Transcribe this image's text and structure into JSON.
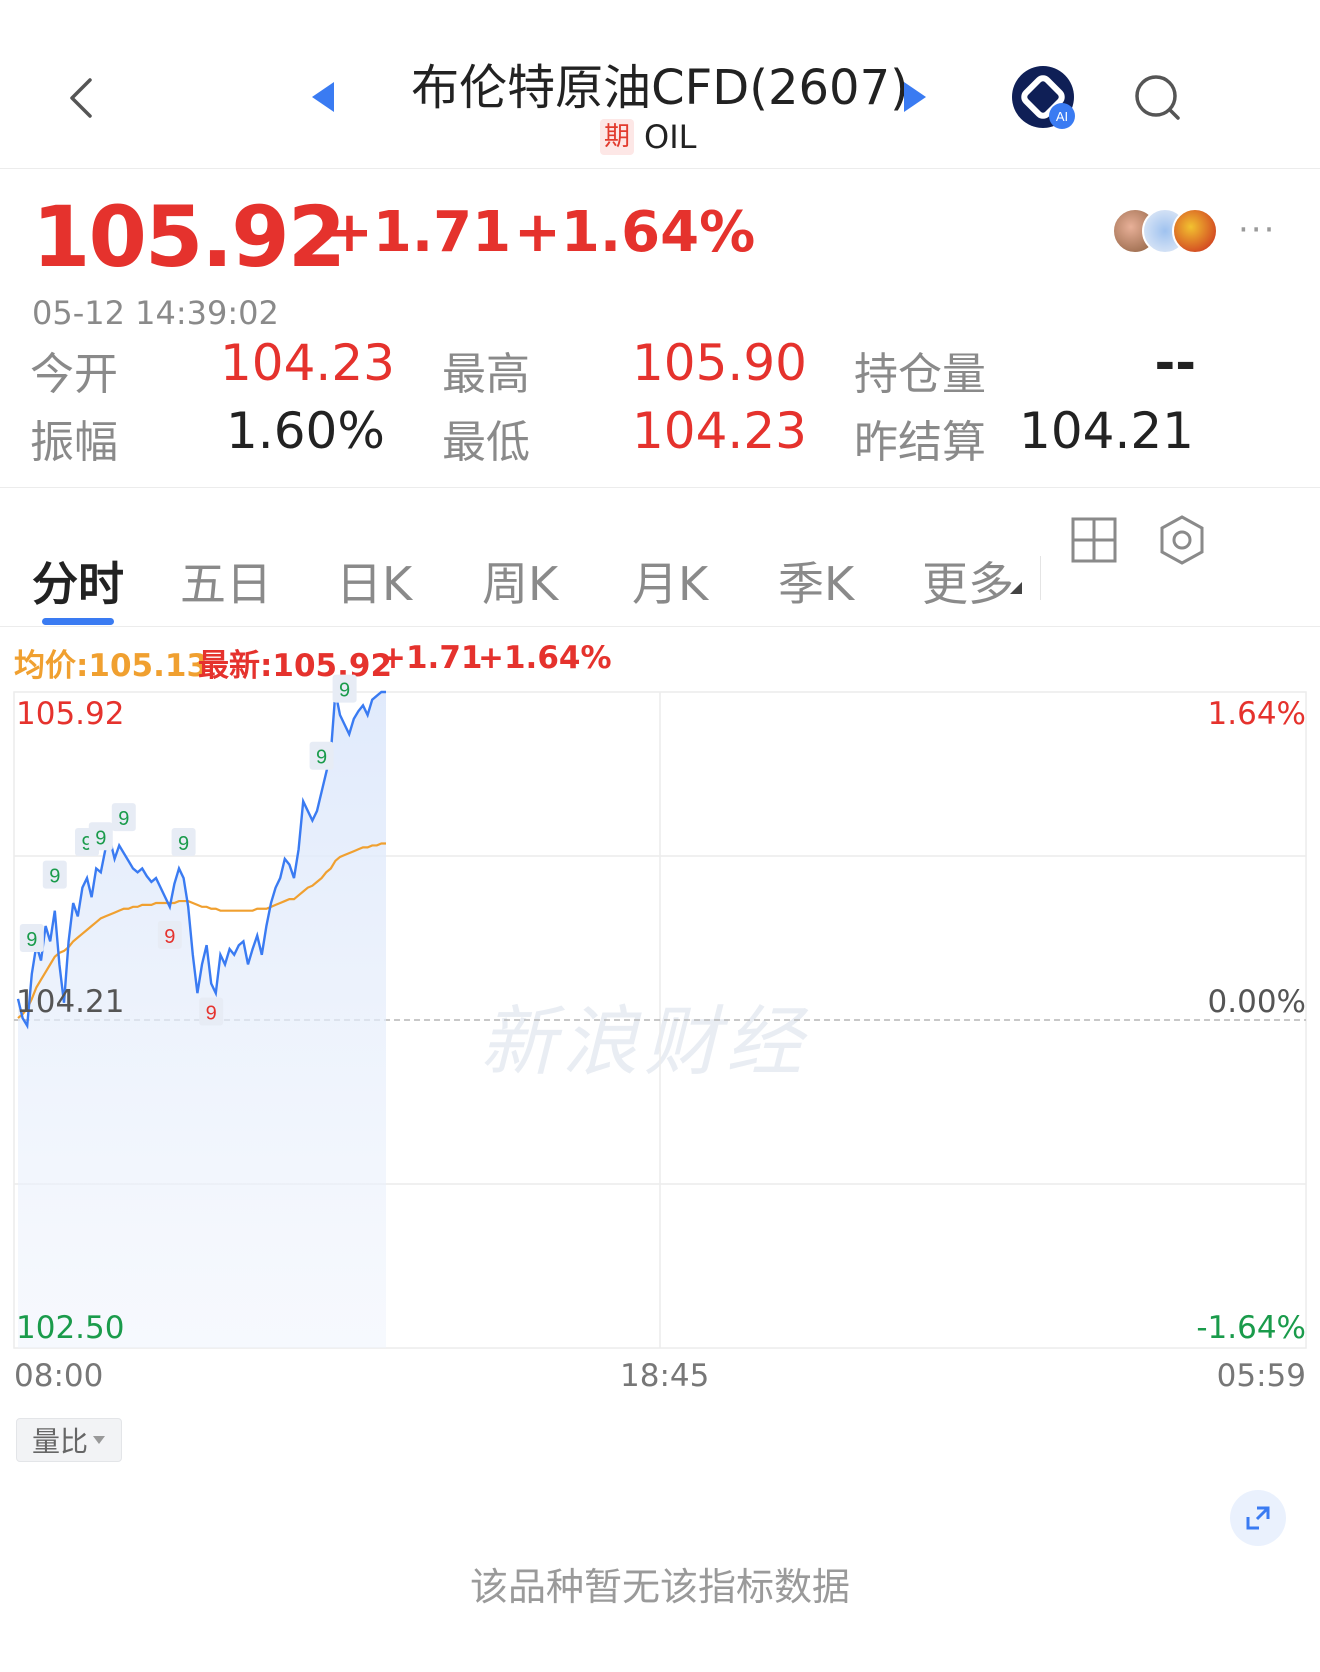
{
  "header": {
    "title": "布伦特原油CFD(2607)",
    "badge": "期",
    "code": "OIL",
    "ai_label": "AI"
  },
  "quote": {
    "price": "105.92",
    "change": "+1.71",
    "change_pct": "+1.64%",
    "timestamp": "05-12 14:39:02",
    "more": "···"
  },
  "stats": {
    "open_label": "今开",
    "open_value": "104.23",
    "high_label": "最高",
    "high_value": "105.90",
    "oi_label": "持仓量",
    "oi_value": "--",
    "amp_label": "振幅",
    "amp_value": "1.60%",
    "low_label": "最低",
    "low_value": "104.23",
    "settle_label": "昨结算",
    "settle_value": "104.21"
  },
  "tabs": [
    "分时",
    "五日",
    "日K",
    "周K",
    "月K",
    "季K",
    "更多"
  ],
  "legend": {
    "avg": "均价:105.13",
    "latest": "最新:105.92",
    "change": "+1.71",
    "change_pct": "+1.64%"
  },
  "chart_labels": {
    "top_price": "105.92",
    "top_pct": "1.64%",
    "mid_price": "104.21",
    "mid_pct": "0.00%",
    "bottom_price": "102.50",
    "bottom_pct": "-1.64%",
    "time_start": "08:00",
    "time_mid": "18:45",
    "time_end": "05:59",
    "watermark": "新浪财经"
  },
  "controls": {
    "ratio": "量比",
    "no_data": "该品种暂无该指标数据"
  },
  "colors": {
    "up": "#e5322d",
    "down": "#1a9b4b",
    "price_line": "#3a7bf2",
    "avg_line": "#f0a030",
    "accent": "#3a7bf2"
  },
  "chart_data": {
    "type": "line",
    "ylim": [
      102.5,
      105.92
    ],
    "baseline": 104.21,
    "x": [
      "08:00",
      "08:05",
      "08:10",
      "08:15",
      "08:20",
      "08:25",
      "08:30",
      "08:35",
      "08:40",
      "08:45",
      "08:50",
      "08:55",
      "09:00",
      "09:05",
      "09:10",
      "09:15",
      "09:20",
      "09:25",
      "09:30",
      "09:35",
      "09:40",
      "09:45",
      "09:50",
      "09:55",
      "10:00",
      "10:05",
      "10:10",
      "10:15",
      "10:20",
      "10:25",
      "10:30",
      "10:35",
      "10:40",
      "10:45",
      "10:50",
      "10:55",
      "11:00",
      "11:05",
      "11:10",
      "11:15",
      "11:20",
      "11:25",
      "11:30",
      "11:35",
      "11:40",
      "11:45",
      "11:50",
      "11:55",
      "12:00",
      "12:05",
      "12:10",
      "12:15",
      "12:20",
      "12:25",
      "12:30",
      "12:35",
      "12:40",
      "12:45",
      "12:50",
      "12:55",
      "13:00",
      "13:05",
      "13:10",
      "13:15",
      "13:20",
      "13:25",
      "13:30",
      "13:35",
      "13:40",
      "13:45",
      "13:50",
      "13:55",
      "14:00",
      "14:05",
      "14:10",
      "14:15",
      "14:20",
      "14:25",
      "14:30",
      "14:35",
      "14:39"
    ],
    "series": [
      {
        "values": [
          104.32,
          104.22,
          104.18,
          104.45,
          104.6,
          104.52,
          104.7,
          104.62,
          104.78,
          104.5,
          104.3,
          104.62,
          104.82,
          104.75,
          104.9,
          104.95,
          104.85,
          105.0,
          104.98,
          105.1,
          105.15,
          105.05,
          105.12,
          105.08,
          105.04,
          105.0,
          104.98,
          105.0,
          104.96,
          104.93,
          104.95,
          104.9,
          104.85,
          104.8,
          104.92,
          105.0,
          104.95,
          104.8,
          104.55,
          104.35,
          104.5,
          104.6,
          104.4,
          104.35,
          104.55,
          104.5,
          104.58,
          104.55,
          104.6,
          104.62,
          104.5,
          104.58,
          104.65,
          104.55,
          104.7,
          104.82,
          104.9,
          104.95,
          105.05,
          105.02,
          104.95,
          105.1,
          105.35,
          105.3,
          105.25,
          105.3,
          105.4,
          105.5,
          105.6,
          105.92,
          105.8,
          105.75,
          105.7,
          105.78,
          105.82,
          105.85,
          105.8,
          105.88,
          105.9,
          105.92,
          105.92
        ]
      },
      {
        "values": [
          104.22,
          104.24,
          104.27,
          104.32,
          104.38,
          104.42,
          104.46,
          104.5,
          104.54,
          104.56,
          104.57,
          104.59,
          104.62,
          104.64,
          104.66,
          104.68,
          104.7,
          104.72,
          104.74,
          104.75,
          104.76,
          104.77,
          104.78,
          104.79,
          104.79,
          104.8,
          104.8,
          104.81,
          104.81,
          104.81,
          104.82,
          104.82,
          104.82,
          104.82,
          104.82,
          104.83,
          104.83,
          104.83,
          104.82,
          104.81,
          104.8,
          104.8,
          104.79,
          104.79,
          104.78,
          104.78,
          104.78,
          104.78,
          104.78,
          104.78,
          104.78,
          104.78,
          104.79,
          104.79,
          104.79,
          104.8,
          104.81,
          104.82,
          104.83,
          104.84,
          104.84,
          104.86,
          104.88,
          104.9,
          104.91,
          104.93,
          104.95,
          104.98,
          105.0,
          105.04,
          105.06,
          105.07,
          105.08,
          105.09,
          105.1,
          105.11,
          105.11,
          105.12,
          105.12,
          105.13,
          105.13
        ]
      }
    ],
    "markers": [
      {
        "index": 3,
        "label": "9",
        "kind": "up"
      },
      {
        "index": 8,
        "label": "9",
        "kind": "up"
      },
      {
        "index": 15,
        "label": "9",
        "kind": "up"
      },
      {
        "index": 18,
        "label": "9",
        "kind": "up"
      },
      {
        "index": 23,
        "label": "9",
        "kind": "up"
      },
      {
        "index": 36,
        "label": "9",
        "kind": "up"
      },
      {
        "index": 33,
        "label": "9",
        "kind": "down"
      },
      {
        "index": 42,
        "label": "9",
        "kind": "down"
      },
      {
        "index": 66,
        "label": "9",
        "kind": "up"
      },
      {
        "index": 71,
        "label": "9",
        "kind": "up"
      }
    ]
  }
}
